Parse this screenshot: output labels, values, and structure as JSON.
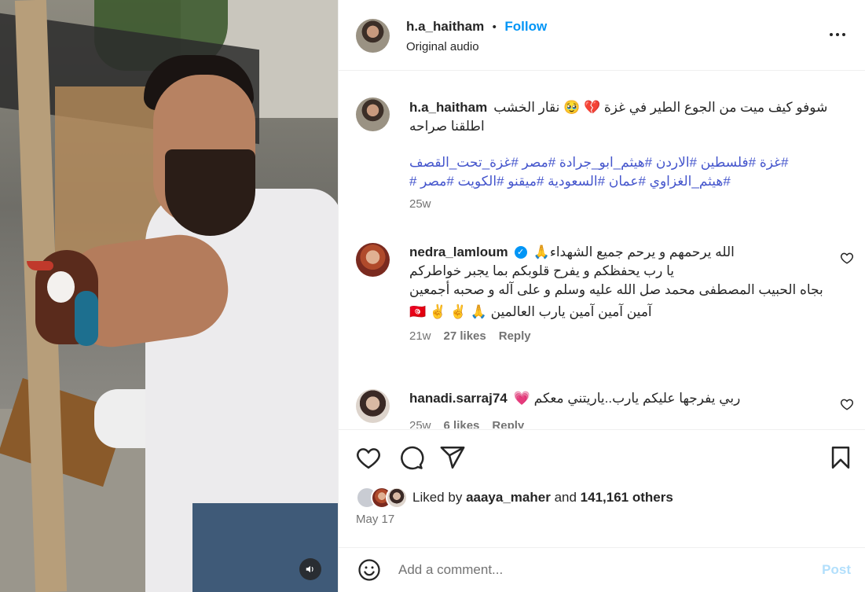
{
  "post": {
    "username": "h.a_haitham",
    "separator": "•",
    "follow_label": "Follow",
    "audio_label": "Original audio"
  },
  "caption": {
    "username": "h.a_haitham",
    "text_line1": "شوفو كيف ميت من الجوع الطير في غزة 💔 🥹 نقار الخشب",
    "text_line2": "اطلقنا صراحه",
    "hashtags_line1": "#غزة #فلسطين #الاردن #هيثم_ابو_جرادة #مصر #غزة_تحت_القصف",
    "hashtags_line2": "#هيثم_الغزاوي #عمان #السعودية #ميقنو #الكويت #مصر #",
    "time": "25w"
  },
  "comments": [
    {
      "username": "nedra_lamloum",
      "verified": "✓",
      "lines": [
        "الله يرحمهم و يرحم جميع الشهداء🙏",
        "يا رب يحفظكم و يفرح قلوبكم بما يجبر خواطركم",
        "بجاه الحبيب المصطفى محمد صل الله عليه وسلم و على آله و صحبه أجمعين",
        "آمين آمين آمين يارب العالمين 🙏 ✌️ ✌️ 🇹🇳"
      ],
      "time": "21w",
      "likes": "27 likes",
      "reply": "Reply"
    },
    {
      "username": "hanadi.sarraj74",
      "lines": [
        "ربي يفرجها عليكم يارب..ياريتني معكم 💗"
      ],
      "time": "25w",
      "likes": "6 likes",
      "reply": "Reply"
    }
  ],
  "likes": {
    "prefix": "Liked by",
    "user": "aaaya_maher",
    "and": "and",
    "count": "141,161 others"
  },
  "date": "May 17",
  "add_comment": {
    "placeholder": "Add a comment...",
    "post_label": "Post"
  },
  "icons": {
    "audio": "speaker-icon",
    "more": "more-horizontal-icon",
    "like": "heart-icon",
    "comment": "comment-bubble-icon",
    "share": "paper-plane-icon",
    "save": "bookmark-icon",
    "emoji": "smiley-icon"
  },
  "colors": {
    "accent": "#0095f6",
    "hashtag": "#4455cc",
    "muted": "#737373",
    "post_disabled": "#b2dffc"
  }
}
